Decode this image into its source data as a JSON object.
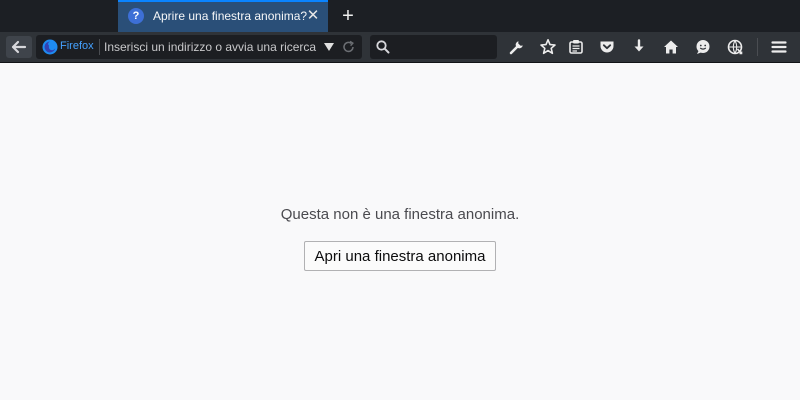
{
  "tab": {
    "title": "Aprire una finestra anonima?",
    "favicon": "question-icon",
    "favicon_glyph": "?",
    "close_glyph": "✕"
  },
  "new_tab_glyph": "+",
  "urlbar": {
    "identity_label": "Firefox",
    "placeholder": "Inserisci un indirizzo o avvia una ricerca"
  },
  "toolbar_icons": [
    "back-arrow-icon",
    "wrench-icon",
    "star-icon",
    "reading-list-icon",
    "pocket-icon",
    "download-icon",
    "home-icon",
    "feedback-icon",
    "sync-icon",
    "hamburger-menu-icon"
  ],
  "page": {
    "message": "Questa non è una finestra anonima.",
    "button_label": "Apri una finestra anonima"
  },
  "colors": {
    "tab_strip": "#1c1f24",
    "selected_tab": "#2a4f78",
    "accent": "#0a84ff",
    "navbar": "#2f3338",
    "identity": "#45a1ff",
    "page_bg": "#f9f9fa"
  }
}
